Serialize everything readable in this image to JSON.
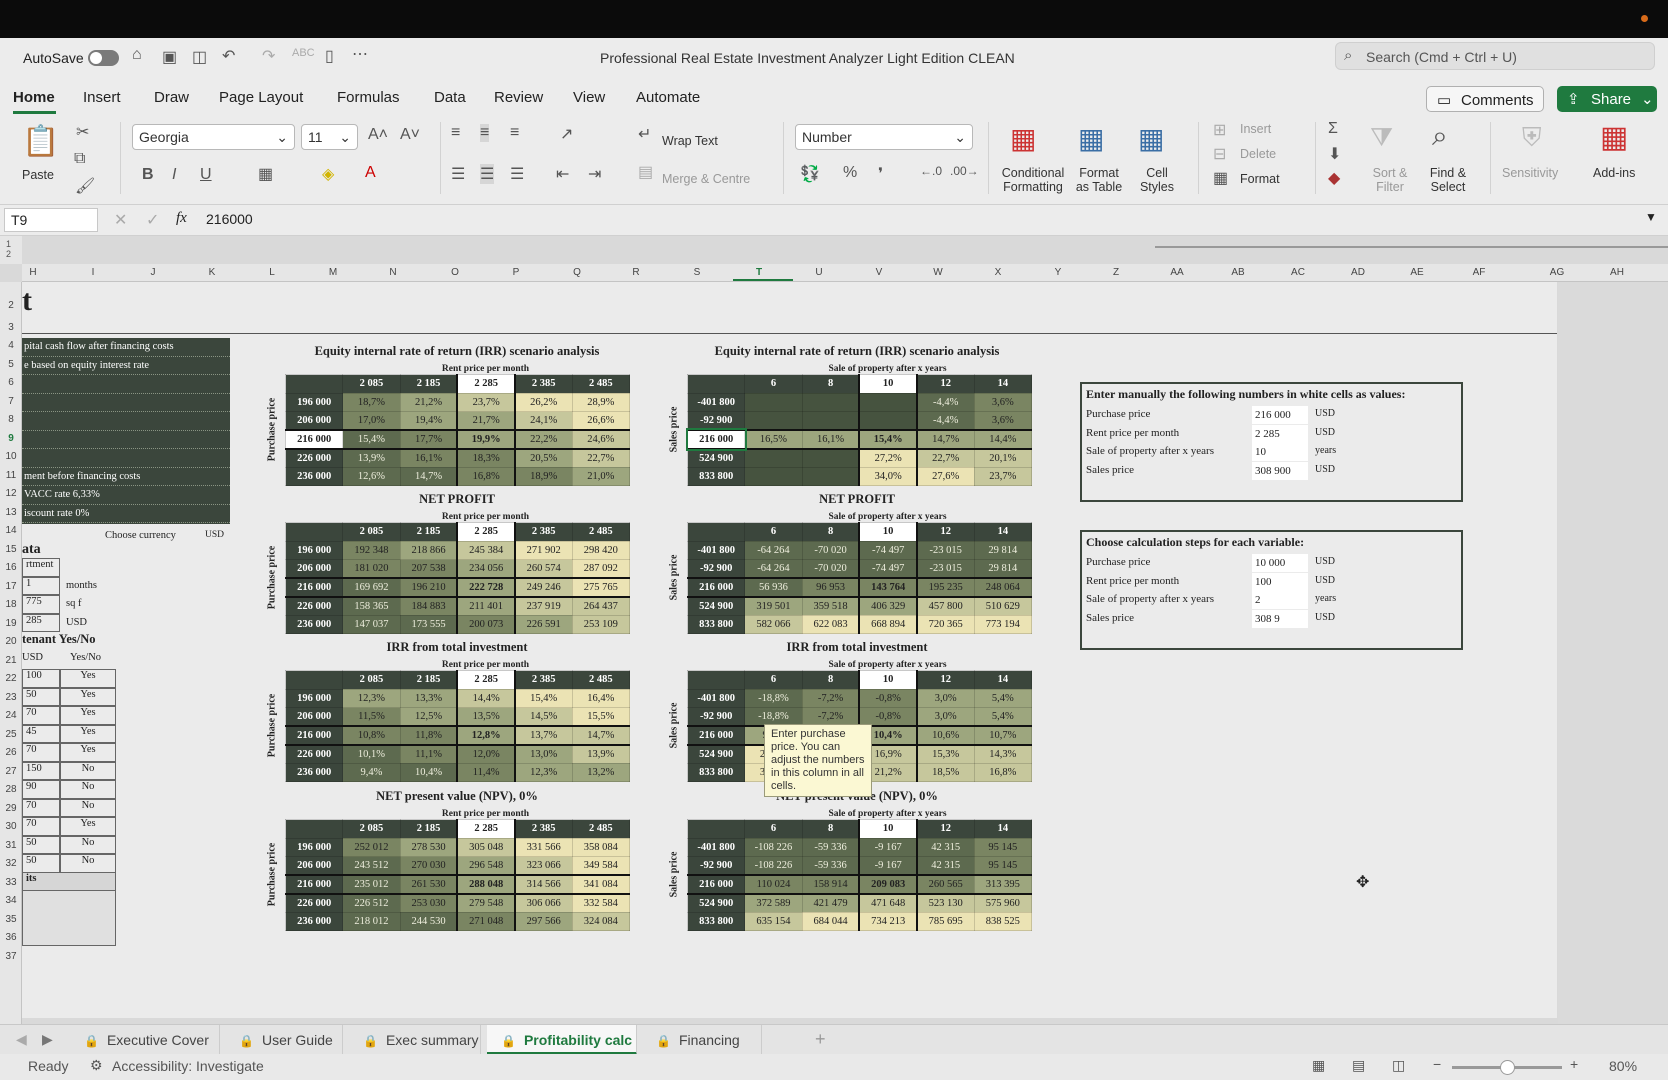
{
  "titlebar": {
    "autosave": "AutoSave",
    "doc_title": "Professional Real Estate Investment  Analyzer Light Edition CLEAN",
    "search_placeholder": "Search (Cmd + Ctrl + U)"
  },
  "tabs": [
    "Home",
    "Insert",
    "Draw",
    "Page Layout",
    "Formulas",
    "Data",
    "Review",
    "View",
    "Automate"
  ],
  "buttons": {
    "comments": "Comments",
    "share": "Share"
  },
  "ribbon": {
    "paste": "Paste",
    "font_name": "Georgia",
    "font_size": "11",
    "bold": "B",
    "italic": "I",
    "underline": "U",
    "wrap_text": "Wrap Text",
    "merge": "Merge & Centre",
    "number_format": "Number",
    "percent": "%",
    "cond_format": [
      "Conditional",
      "Formatting"
    ],
    "format_table": [
      "Format",
      "as Table"
    ],
    "cell_styles": [
      "Cell",
      "Styles"
    ],
    "insert": "Insert",
    "delete": "Delete",
    "format": "Format",
    "sort_filter": [
      "Sort &",
      "Filter"
    ],
    "find_select": [
      "Find &",
      "Select"
    ],
    "sensitivity": "Sensitivity",
    "addins": "Add-ins"
  },
  "formula_bar": {
    "cell_ref": "T9",
    "fx": "fx",
    "value": "216000"
  },
  "columns": [
    "H",
    "I",
    "J",
    "K",
    "L",
    "M",
    "N",
    "O",
    "P",
    "Q",
    "R",
    "S",
    "T",
    "U",
    "V",
    "W",
    "X",
    "Y",
    "Z",
    "AA",
    "AB",
    "AC",
    "AD",
    "AE",
    "AF",
    "AG",
    "AH"
  ],
  "rows": [
    "2",
    "3",
    "4",
    "5",
    "6",
    "7",
    "8",
    "9",
    "10",
    "11",
    "12",
    "13",
    "14",
    "15",
    "16",
    "17",
    "18",
    "19",
    "20",
    "21",
    "22",
    "23",
    "24",
    "25",
    "26",
    "27",
    "28",
    "29",
    "30",
    "31",
    "32",
    "33",
    "34",
    "35",
    "36",
    "37"
  ],
  "sheet": {
    "big_title": "t",
    "left_panel": [
      "pital cash flow after financing costs",
      "e based on equity interest rate",
      "",
      "",
      "",
      "",
      "",
      "ment before financing costs",
      "VACC rate 6,33%",
      "iscount rate 0%"
    ],
    "choose_currency": "Choose currency",
    "currency": "USD",
    "data_heading": "ata",
    "data_rows": [
      {
        "a": "rtment",
        "b": "",
        "c": ""
      },
      {
        "a": "1",
        "b": "months",
        "c": ""
      },
      {
        "a": "775",
        "b": "sq f",
        "c": ""
      },
      {
        "a": "285",
        "b": "USD",
        "c": ""
      }
    ],
    "tenant_heading": "tenant Yes/No",
    "tenant_header": {
      "a": "USD",
      "b": "Yes/No"
    },
    "tenant_rows": [
      {
        "a": "100",
        "b": "Yes"
      },
      {
        "a": "50",
        "b": "Yes"
      },
      {
        "a": "70",
        "b": "Yes"
      },
      {
        "a": "45",
        "b": "Yes"
      },
      {
        "a": "70",
        "b": "Yes"
      },
      {
        "a": "150",
        "b": "No"
      },
      {
        "a": "90",
        "b": "No"
      },
      {
        "a": "70",
        "b": "No"
      },
      {
        "a": "70",
        "b": "Yes"
      },
      {
        "a": "50",
        "b": "No"
      },
      {
        "a": "50",
        "b": "No"
      }
    ],
    "tenant_footer": "its",
    "left_label_purchase": "Purchase price",
    "left_label_sales": "Sales price",
    "sub_rent": "Rent price per month",
    "sub_sale": "Sale of property after x years",
    "left_tables": [
      {
        "title": "Equity internal rate of return (IRR) scenario analysis",
        "cols": [
          "2 085",
          "2 185",
          "2 285",
          "2 385",
          "2 485"
        ],
        "rows": [
          {
            "label": "196 000",
            "vals": [
              "18,7%",
              "21,2%",
              "23,7%",
              "26,2%",
              "28,9%"
            ]
          },
          {
            "label": "206 000",
            "vals": [
              "17,0%",
              "19,4%",
              "21,7%",
              "24,1%",
              "26,6%"
            ]
          },
          {
            "label": "216 000",
            "vals": [
              "15,4%",
              "17,7%",
              "19,9%",
              "22,2%",
              "24,6%"
            ]
          },
          {
            "label": "226 000",
            "vals": [
              "13,9%",
              "16,1%",
              "18,3%",
              "20,5%",
              "22,7%"
            ]
          },
          {
            "label": "236 000",
            "vals": [
              "12,6%",
              "14,7%",
              "16,8%",
              "18,9%",
              "21,0%"
            ]
          }
        ]
      },
      {
        "title": "NET PROFIT",
        "cols": [
          "2 085",
          "2 185",
          "2 285",
          "2 385",
          "2 485"
        ],
        "rows": [
          {
            "label": "196 000",
            "vals": [
              "192 348",
              "218 866",
              "245 384",
              "271 902",
              "298 420"
            ]
          },
          {
            "label": "206 000",
            "vals": [
              "181 020",
              "207 538",
              "234 056",
              "260 574",
              "287 092"
            ]
          },
          {
            "label": "216 000",
            "vals": [
              "169 692",
              "196 210",
              "222 728",
              "249 246",
              "275 765"
            ]
          },
          {
            "label": "226 000",
            "vals": [
              "158 365",
              "184 883",
              "211 401",
              "237 919",
              "264 437"
            ]
          },
          {
            "label": "236 000",
            "vals": [
              "147 037",
              "173 555",
              "200 073",
              "226 591",
              "253 109"
            ]
          }
        ]
      },
      {
        "title": "IRR from total investment",
        "cols": [
          "2 085",
          "2 185",
          "2 285",
          "2 385",
          "2 485"
        ],
        "rows": [
          {
            "label": "196 000",
            "vals": [
              "12,3%",
              "13,3%",
              "14,4%",
              "15,4%",
              "16,4%"
            ]
          },
          {
            "label": "206 000",
            "vals": [
              "11,5%",
              "12,5%",
              "13,5%",
              "14,5%",
              "15,5%"
            ]
          },
          {
            "label": "216 000",
            "vals": [
              "10,8%",
              "11,8%",
              "12,8%",
              "13,7%",
              "14,7%"
            ]
          },
          {
            "label": "226 000",
            "vals": [
              "10,1%",
              "11,1%",
              "12,0%",
              "13,0%",
              "13,9%"
            ]
          },
          {
            "label": "236 000",
            "vals": [
              "9,4%",
              "10,4%",
              "11,4%",
              "12,3%",
              "13,2%"
            ]
          }
        ]
      },
      {
        "title": "NET present value (NPV), 0%",
        "cols": [
          "2 085",
          "2 185",
          "2 285",
          "2 385",
          "2 485"
        ],
        "rows": [
          {
            "label": "196 000",
            "vals": [
              "252 012",
              "278 530",
              "305 048",
              "331 566",
              "358 084"
            ]
          },
          {
            "label": "206 000",
            "vals": [
              "243 512",
              "270 030",
              "296 548",
              "323 066",
              "349 584"
            ]
          },
          {
            "label": "216 000",
            "vals": [
              "235 012",
              "261 530",
              "288 048",
              "314 566",
              "341 084"
            ]
          },
          {
            "label": "226 000",
            "vals": [
              "226 512",
              "253 030",
              "279 548",
              "306 066",
              "332 584"
            ]
          },
          {
            "label": "236 000",
            "vals": [
              "218 012",
              "244 530",
              "271 048",
              "297 566",
              "324 084"
            ]
          }
        ]
      }
    ],
    "right_tables": [
      {
        "title": "Equity internal rate of return (IRR) scenario analysis",
        "cols": [
          "6",
          "8",
          "10",
          "12",
          "14"
        ],
        "rows": [
          {
            "label": "-401 800",
            "vals": [
              "",
              "",
              "",
              "-4,4%",
              "3,6%"
            ]
          },
          {
            "label": "-92 900",
            "vals": [
              "",
              "",
              "",
              "-4,4%",
              "3,6%"
            ]
          },
          {
            "label": "216 000",
            "vals": [
              "16,5%",
              "16,1%",
              "15,4%",
              "14,7%",
              "14,4%"
            ]
          },
          {
            "label": "524 900",
            "vals": [
              "",
              "",
              "27,2%",
              "22,7%",
              "20,1%"
            ]
          },
          {
            "label": "833 800",
            "vals": [
              "",
              "",
              "34,0%",
              "27,6%",
              "23,7%"
            ]
          }
        ]
      },
      {
        "title": "NET PROFIT",
        "cols": [
          "6",
          "8",
          "10",
          "12",
          "14"
        ],
        "rows": [
          {
            "label": "-401 800",
            "vals": [
              "-64 264",
              "-70 020",
              "-74 497",
              "-23 015",
              "29 814"
            ]
          },
          {
            "label": "-92 900",
            "vals": [
              "-64 264",
              "-70 020",
              "-74 497",
              "-23 015",
              "29 814"
            ]
          },
          {
            "label": "216 000",
            "vals": [
              "56 936",
              "96 953",
              "143 764",
              "195 235",
              "248 064"
            ]
          },
          {
            "label": "524 900",
            "vals": [
              "319 501",
              "359 518",
              "406 329",
              "457 800",
              "510 629"
            ]
          },
          {
            "label": "833 800",
            "vals": [
              "582 066",
              "622 083",
              "668 894",
              "720 365",
              "773 194"
            ]
          }
        ]
      },
      {
        "title": "IRR from total investment",
        "cols": [
          "6",
          "8",
          "10",
          "12",
          "14"
        ],
        "rows": [
          {
            "label": "-401 800",
            "vals": [
              "-18,8%",
              "-7,2%",
              "-0,8%",
              "3,0%",
              "5,4%"
            ]
          },
          {
            "label": "-92 900",
            "vals": [
              "-18,8%",
              "-7,2%",
              "-0,8%",
              "3,0%",
              "5,4%"
            ]
          },
          {
            "label": "216 000",
            "vals": [
              "9,9%",
              "10,2%",
              "10,4%",
              "10,6%",
              "10,7%"
            ]
          },
          {
            "label": "524 900",
            "vals": [
              "24,5%",
              "19,5%",
              "16,9%",
              "15,3%",
              "14,3%"
            ]
          },
          {
            "label": "833 800",
            "vals": [
              "34,1%",
              "25,6%",
              "21,2%",
              "18,5%",
              "16,8%"
            ]
          }
        ]
      },
      {
        "title": "NET present value (NPV), 0%",
        "cols": [
          "6",
          "8",
          "10",
          "12",
          "14"
        ],
        "rows": [
          {
            "label": "-401 800",
            "vals": [
              "-108 226",
              "-59 336",
              "-9 167",
              "42 315",
              "95 145"
            ]
          },
          {
            "label": "-92 900",
            "vals": [
              "-108 226",
              "-59 336",
              "-9 167",
              "42 315",
              "95 145"
            ]
          },
          {
            "label": "216 000",
            "vals": [
              "110 024",
              "158 914",
              "209 083",
              "260 565",
              "313 395"
            ]
          },
          {
            "label": "524 900",
            "vals": [
              "372 589",
              "421 479",
              "471 648",
              "523 130",
              "575 960"
            ]
          },
          {
            "label": "833 800",
            "vals": [
              "635 154",
              "684 044",
              "734 213",
              "785 695",
              "838 525"
            ]
          }
        ]
      }
    ],
    "tooltip": [
      "Enter purchase",
      "price. You can",
      "adjust the numbers",
      "in this column in all",
      "cells."
    ],
    "input_box": {
      "title": "Enter manually the following numbers in white cells as values:",
      "rows": [
        {
          "label": "Purchase price",
          "value": "216 000",
          "unit": "USD"
        },
        {
          "label": "Rent price per month",
          "value": "2 285",
          "unit": "USD"
        },
        {
          "label": "Sale of property after x years",
          "value": "10",
          "unit": "years"
        },
        {
          "label": "Sales price",
          "value": "308 900",
          "unit": "USD"
        }
      ]
    },
    "steps_box": {
      "title": "Choose calculation steps for each variable:",
      "rows": [
        {
          "label": "Purchase price",
          "value": "10 000",
          "unit": "USD"
        },
        {
          "label": "Rent price per month",
          "value": "100",
          "unit": "USD"
        },
        {
          "label": "Sale of property after x years",
          "value": "2",
          "unit": "years"
        },
        {
          "label": "Sales price",
          "value": "308 9",
          "unit": "USD"
        }
      ]
    }
  },
  "sheet_tabs": [
    "Executive Cover",
    "User Guide",
    "Exec summary",
    "Profitability calc",
    "Financing"
  ],
  "status": {
    "ready": "Ready",
    "accessibility": "Accessibility: Investigate",
    "zoom": "80%"
  },
  "colors": {
    "dark_green": "#3b463c",
    "active_tab": "#1f7a3f",
    "share": "#1f7a3f"
  }
}
